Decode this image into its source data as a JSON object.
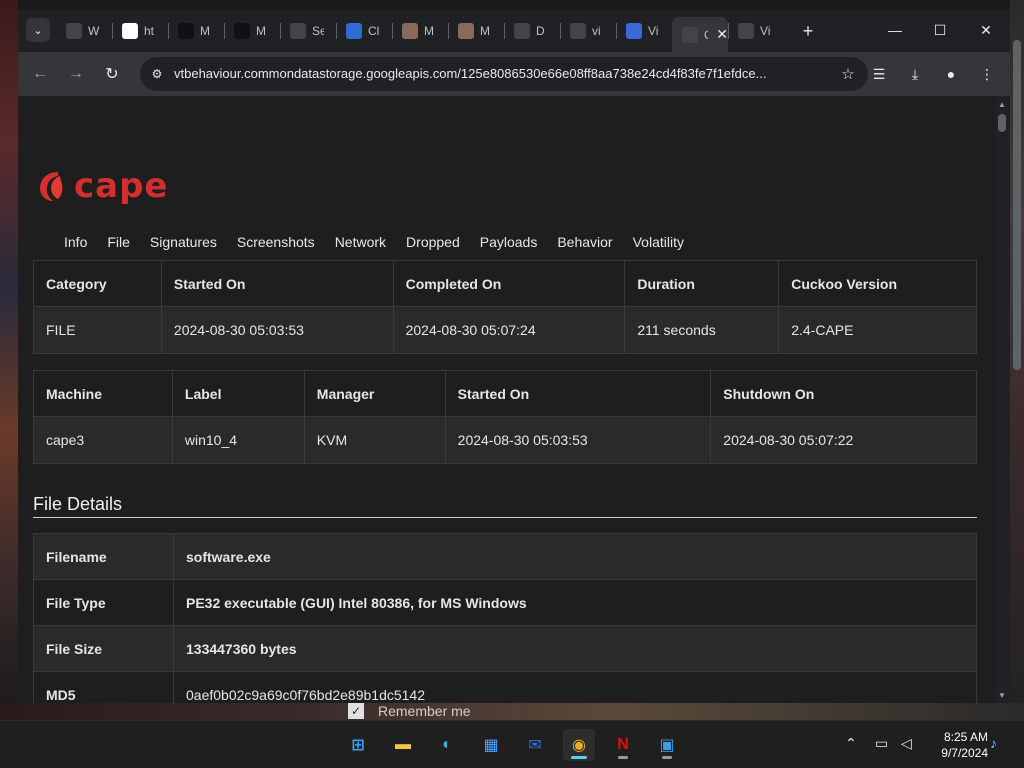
{
  "browser": {
    "tabs": [
      {
        "label": "W",
        "icon": "github-icon",
        "color": "#444"
      },
      {
        "label": "ht",
        "icon": "google-icon",
        "color": "#fff"
      },
      {
        "label": "M",
        "icon": "malware-icon",
        "color": "#111"
      },
      {
        "label": "M",
        "icon": "malware-icon",
        "color": "#111"
      },
      {
        "label": "Se",
        "icon": "gear-icon",
        "color": "#444"
      },
      {
        "label": "Cl",
        "icon": "cloud-icon",
        "color": "#2b6cd6"
      },
      {
        "label": "M",
        "icon": "avatar-icon",
        "color": "#8a6a5a"
      },
      {
        "label": "M",
        "icon": "avatar-icon",
        "color": "#8a6a5a"
      },
      {
        "label": "D",
        "icon": "download-icon",
        "color": "#444"
      },
      {
        "label": "vi",
        "icon": "loading-icon",
        "color": "#444"
      },
      {
        "label": "Vi",
        "icon": "virustotal-icon",
        "color": "#3a6ad6"
      },
      {
        "label": "Cl",
        "icon": "cape-icon",
        "color": "#444",
        "active": true
      },
      {
        "label": "Vi",
        "icon": "globe-icon",
        "color": "#444"
      }
    ],
    "url": "vtbehaviour.commondatastorage.googleapis.com/125e8086530e66e08ff8aa738e24cd4f83fe7f1efdce...",
    "colors": {
      "frame": "#202124",
      "toolbar": "#35363a",
      "accent": "#d32f2f"
    }
  },
  "page": {
    "logo_text": "cape",
    "nav": [
      "Info",
      "File",
      "Signatures",
      "Screenshots",
      "Network",
      "Dropped",
      "Payloads",
      "Behavior",
      "Volatility"
    ],
    "info_table": {
      "headers": [
        "Category",
        "Started On",
        "Completed On",
        "Duration",
        "Cuckoo Version"
      ],
      "row": [
        "FILE",
        "2024-08-30 05:03:53",
        "2024-08-30 05:07:24",
        "211 seconds",
        "2.4-CAPE"
      ]
    },
    "machine_table": {
      "headers": [
        "Machine",
        "Label",
        "Manager",
        "Started On",
        "Shutdown On"
      ],
      "row": [
        "cape3",
        "win10_4",
        "KVM",
        "2024-08-30 05:03:53",
        "2024-08-30 05:07:22"
      ]
    },
    "file_details_title": "File Details",
    "file_details": [
      {
        "key": "Filename",
        "value": "software.exe"
      },
      {
        "key": "File Type",
        "value": "PE32 executable (GUI) Intel 80386, for MS Windows"
      },
      {
        "key": "File Size",
        "value": "133447360 bytes"
      },
      {
        "key": "MD5",
        "value": "0aef0b02c9a69c0f76bd2e89b1dc5142"
      }
    ]
  },
  "overlay": {
    "remember_me": "Remember me"
  },
  "taskbar": {
    "apps": [
      "windows-start-icon",
      "file-explorer-icon",
      "edge-icon",
      "store-icon",
      "outlook-icon",
      "chrome-icon",
      "netflix-icon",
      "photos-icon"
    ],
    "time": "8:25 AM",
    "date": "9/7/2024"
  }
}
